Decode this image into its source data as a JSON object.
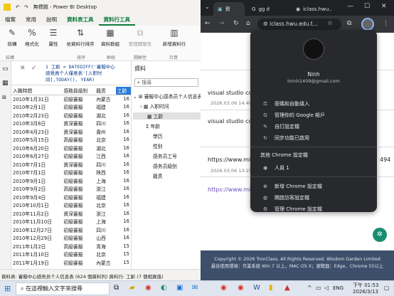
{
  "pbi": {
    "title_window": "無標題 - Power BI Desktop",
    "tabs": [
      "檔案",
      "常用",
      "說明",
      "資料表工具",
      "資料行工具"
    ],
    "ribbon": {
      "buttons": [
        "結構",
        "格式化",
        "屬性",
        "依資料行排序",
        "資料群組",
        "管理關聯性",
        "新增資料行"
      ],
      "groups": [
        "結構",
        "排序",
        "群組",
        "關聯性",
        "計算"
      ]
    },
    "formula": {
      "line1": "1  工齡 = DATEDIFF('審擬中心",
      "line2": "   感覺員个人僅意表'[入职时",
      "line3": "   间],TODAY(), YEAR)"
    },
    "table": {
      "headers": [
        "入職時間",
        "感務員級别",
        "籍贯",
        "工齡"
      ],
      "rows": [
        [
          "2010年1月31日",
          "初級審擬",
          "內蒙古",
          "16"
        ],
        [
          "2010年2月1日",
          "初級審擬",
          "福建",
          "16"
        ],
        [
          "2010年2月23日",
          "初級審擬",
          "湖北",
          "16"
        ],
        [
          "2010年3月6日",
          "資深審擬",
          "四川",
          "16"
        ],
        [
          "2010年4月23日",
          "資深審擬",
          "貴州",
          "16"
        ],
        [
          "2010年5月15日",
          "高級審擬",
          "北京",
          "16"
        ],
        [
          "2010年6月20日",
          "初級審擬",
          "湖北",
          "16"
        ],
        [
          "2010年6月27日",
          "初級審擬",
          "江西",
          "16"
        ],
        [
          "2010年7月1日",
          "資深審擬",
          "四川",
          "16"
        ],
        [
          "2010年7月1日",
          "初級審擬",
          "陕西",
          "16"
        ],
        [
          "2010年9月1日",
          "初級審擬",
          "上海",
          "16"
        ],
        [
          "2010年9月2日",
          "高級審擬",
          "浙江",
          "16"
        ],
        [
          "2010年9月4日",
          "初級審擬",
          "福建",
          "16"
        ],
        [
          "2010年10月1日",
          "初級審擬",
          "北京",
          "16"
        ],
        [
          "2010年11月2日",
          "資深審擬",
          "浙江",
          "16"
        ],
        [
          "2010年11月10日",
          "初級審擬",
          "上海",
          "16"
        ],
        [
          "2010年12月27日",
          "初級審擬",
          "四川",
          "16"
        ],
        [
          "2010年12月29日",
          "初級審擬",
          "山西",
          "16"
        ],
        [
          "2011年1月2日",
          "高級審擬",
          "青海",
          "15"
        ],
        [
          "2011年1月10日",
          "初級審擬",
          "北京",
          "15"
        ],
        [
          "2011年1月19日",
          "初級審擬",
          "內蒙古",
          "15"
        ]
      ]
    },
    "data_pane": {
      "title": "資料",
      "search": "搜尋",
      "table_name": "審擬中心感务员个人信息表",
      "fields": [
        "入职时间",
        "工齡",
        "年齡",
        "學历",
        "性别",
        "感务员工号",
        "感务员級别",
        "籍贯"
      ]
    },
    "status": "資料表: 審擬中心感务员个人信息表 (624 個資料列) 資料行: 工齡 (7 個相異值)"
  },
  "chrome": {
    "tabs": [
      "資",
      "gg d",
      "iclass.hwu..."
    ],
    "address": "iclass.hwu.edu.t...",
    "page": {
      "item1_title": "visual studio co",
      "item1_date": "2026.03.06 14:40",
      "item2_title": "visual studio co",
      "item3_url": "https://www.mic",
      "item3_date": "2026.03.06 13:25",
      "item3_num": "494",
      "item4_link": "https://www.mic",
      "footer1": "Copyright © 2026 TronClass. All Rights Reserved. Wisdom Garden Limited",
      "footer2": "最佳使用環境：作業系統 Win 7 以上，MAC OS X；瀏覽器：Edge、Chrome 55以上"
    },
    "menu": {
      "name": "Ninh",
      "email": "tninh1409@gmail.com",
      "items1": [
        "密碼和自動填入",
        "管理你的 Google 帳戶",
        "自訂設定檔",
        "同步功能已啟用"
      ],
      "section": "其他 Chrome 設定檔",
      "person": "人員 1",
      "items2": [
        "新增 Chrome 設定檔",
        "開啟訪客設定檔",
        "管理 Chrome 設定檔"
      ]
    }
  },
  "taskbar": {
    "search": "在這裡輸入文字來搜尋",
    "lang": "ENG",
    "time": "下午 01:53",
    "date": "2026/3/13"
  }
}
